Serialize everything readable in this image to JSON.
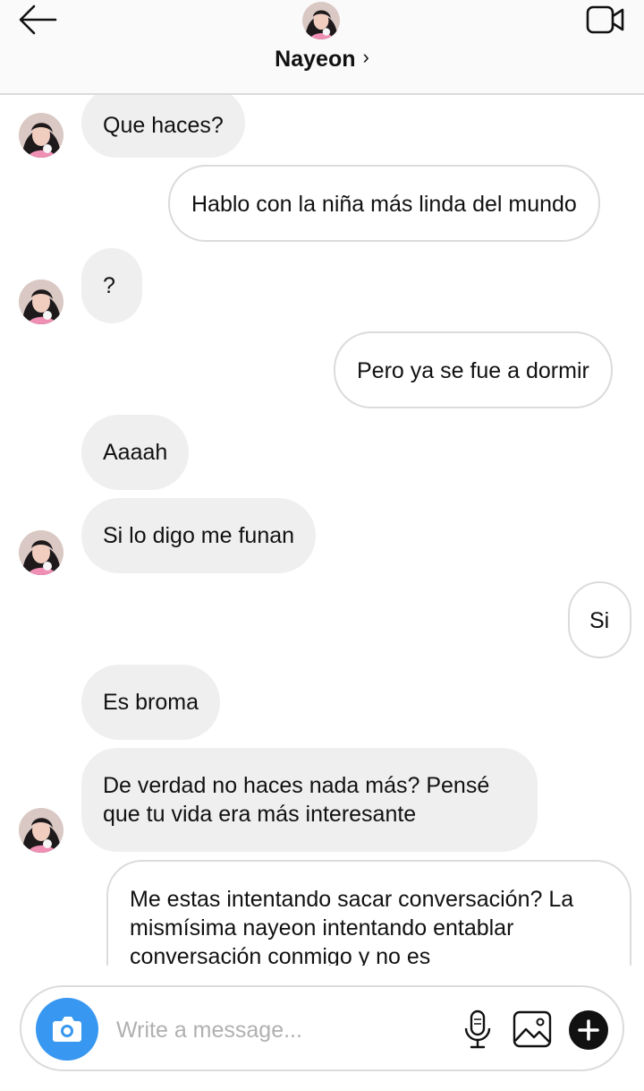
{
  "header": {
    "contact_name": "Nayeon",
    "chevron": "›",
    "back_icon": "arrow-left-icon",
    "video_icon": "video-camera-icon"
  },
  "colors": {
    "incoming_bubble": "#efefef",
    "outgoing_border": "#dbdbdb",
    "camera_button": "#3897f0",
    "placeholder": "#b0b0b0"
  },
  "messages": [
    {
      "from": "them",
      "text": "Que haces?"
    },
    {
      "from": "me",
      "text": "Hablo con la niña más linda del mundo"
    },
    {
      "from": "them",
      "text": "?"
    },
    {
      "from": "me",
      "text": "Pero ya se fue a dormir"
    },
    {
      "from": "them",
      "text": "Aaaah"
    },
    {
      "from": "them",
      "text": "Si lo digo me funan"
    },
    {
      "from": "me",
      "text": "Si"
    },
    {
      "from": "them",
      "text": "Es broma"
    },
    {
      "from": "them",
      "text": "De verdad no haces nada más? Pensé que tu vida era más interesante"
    },
    {
      "from": "me",
      "text": "Me estas intentando sacar conversación? La mismísima nayeon intentando entablar conversación conmigo y no es"
    }
  ],
  "composer": {
    "placeholder": "Write a message...",
    "camera_icon": "camera-icon",
    "mic_icon": "microphone-icon",
    "gallery_icon": "image-gallery-icon",
    "plus_icon": "plus-icon"
  }
}
